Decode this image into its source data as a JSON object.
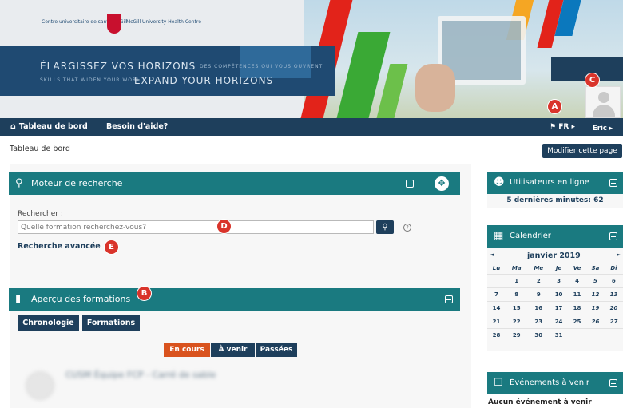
{
  "banner": {
    "logo_text_left": "Centre universitaire de santé McGill",
    "logo_text_right": "McGill University Health Centre",
    "slogan_fr": "ÉLARGISSEZ VOS HORIZONS",
    "slogan_en": "EXPAND YOUR HORIZONS",
    "slogan_small_1": "DES COMPÉTENCES QUI VOUS OUVRENT",
    "slogan_small_2": "SKILLS THAT WIDEN YOUR WORLD"
  },
  "nav": {
    "dashboard": "Tableau de bord",
    "help": "Besoin d'aide?",
    "lang": "FR",
    "user": "Eric"
  },
  "badges": {
    "a": "A",
    "b": "B",
    "c": "C",
    "d": "D",
    "e": "E"
  },
  "breadcrumb": "Tableau de bord",
  "modify_button": "Modifier cette page",
  "search_block": {
    "title": "Moteur de recherche",
    "label": "Rechercher :",
    "placeholder": "Quelle formation recherchez-vous?",
    "advanced": "Recherche avancée"
  },
  "overview_block": {
    "title": "Aperçu des formations",
    "tabs": [
      "Chronologie",
      "Formations"
    ],
    "filters": [
      "En cours",
      "À venir",
      "Passées"
    ],
    "course_title": "CUSM Équipe FCP - Carré de sable",
    "course_badge": "cu"
  },
  "online_block": {
    "title": "Utilisateurs en ligne",
    "text": "5 dernières minutes: 62"
  },
  "calendar_block": {
    "title": "Calendrier",
    "month": "janvier 2019",
    "prev": "◄",
    "next": "►",
    "days": [
      "Lu",
      "Ma",
      "Me",
      "Je",
      "Ve",
      "Sa",
      "Di"
    ],
    "weeks": [
      [
        "",
        "1",
        "2",
        "3",
        "4",
        "5",
        "6"
      ],
      [
        "7",
        "8",
        "9",
        "10",
        "11",
        "12",
        "13"
      ],
      [
        "14",
        "15",
        "16",
        "17",
        "18",
        "19",
        "20"
      ],
      [
        "21",
        "22",
        "23",
        "24",
        "25",
        "26",
        "27"
      ],
      [
        "28",
        "29",
        "30",
        "31",
        "",
        "",
        ""
      ]
    ]
  },
  "events_block": {
    "title": "Événements à venir",
    "text": "Aucun événement à venir"
  },
  "colors": {
    "navy": "#1e3f5c",
    "teal": "#1a7a80",
    "orange": "#d9531e",
    "badge_red": "#d9342b"
  }
}
